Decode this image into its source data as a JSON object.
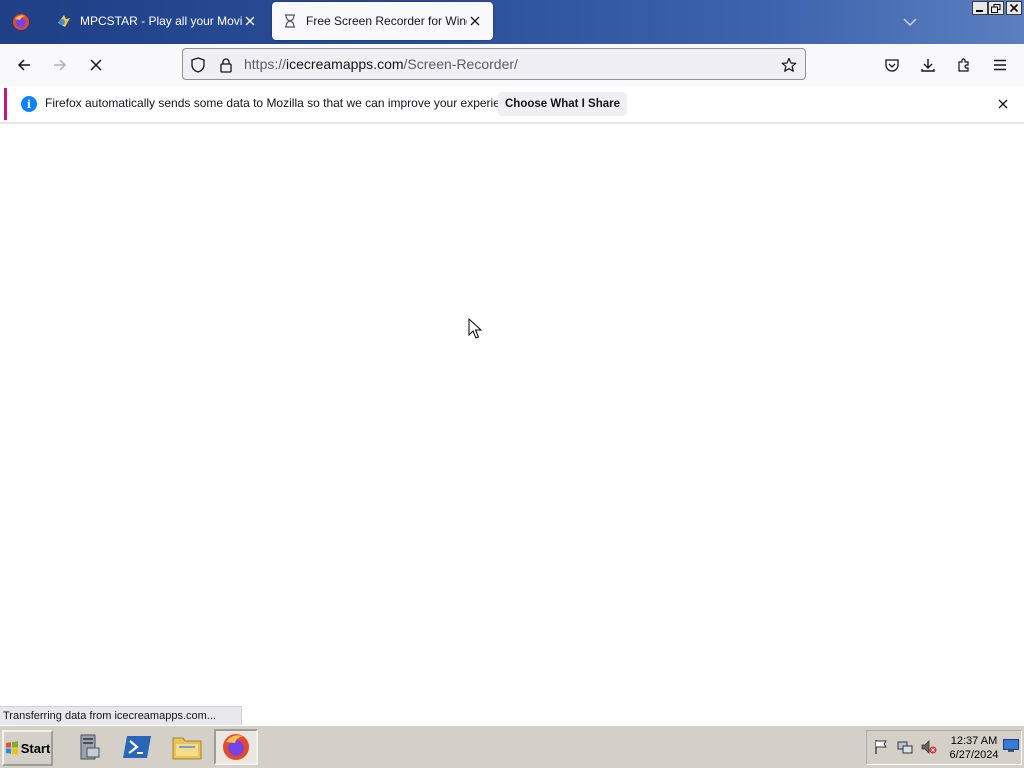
{
  "browser": {
    "tabs": [
      {
        "title": "MPCSTAR - Play all your Movies an",
        "active": false,
        "icon": "mpcstar-icon"
      },
      {
        "title": "Free Screen Recorder for Window",
        "active": true,
        "icon": "loading-hourglass-icon"
      }
    ],
    "url": {
      "scheme": "https://",
      "domain": "icecreamapps.com",
      "path": "/Screen-Recorder/"
    }
  },
  "notification": {
    "message": "Firefox automatically sends some data to Mozilla so that we can improve your experience.",
    "button_label": "Choose What I Share",
    "info_glyph": "i"
  },
  "status_text": "Transferring data from icecreamapps.com...",
  "taskbar": {
    "start_label": "Start",
    "apps": [
      "server-manager-icon",
      "powershell-icon",
      "explorer-icon",
      "firefox-icon"
    ],
    "clock_time": "12:37 AM",
    "clock_date": "6/27/2024"
  },
  "colors": {
    "tabbar_gradient_start": "#1f3f86",
    "notification_accent": "#c9137f",
    "info_blue": "#0a84ff"
  }
}
